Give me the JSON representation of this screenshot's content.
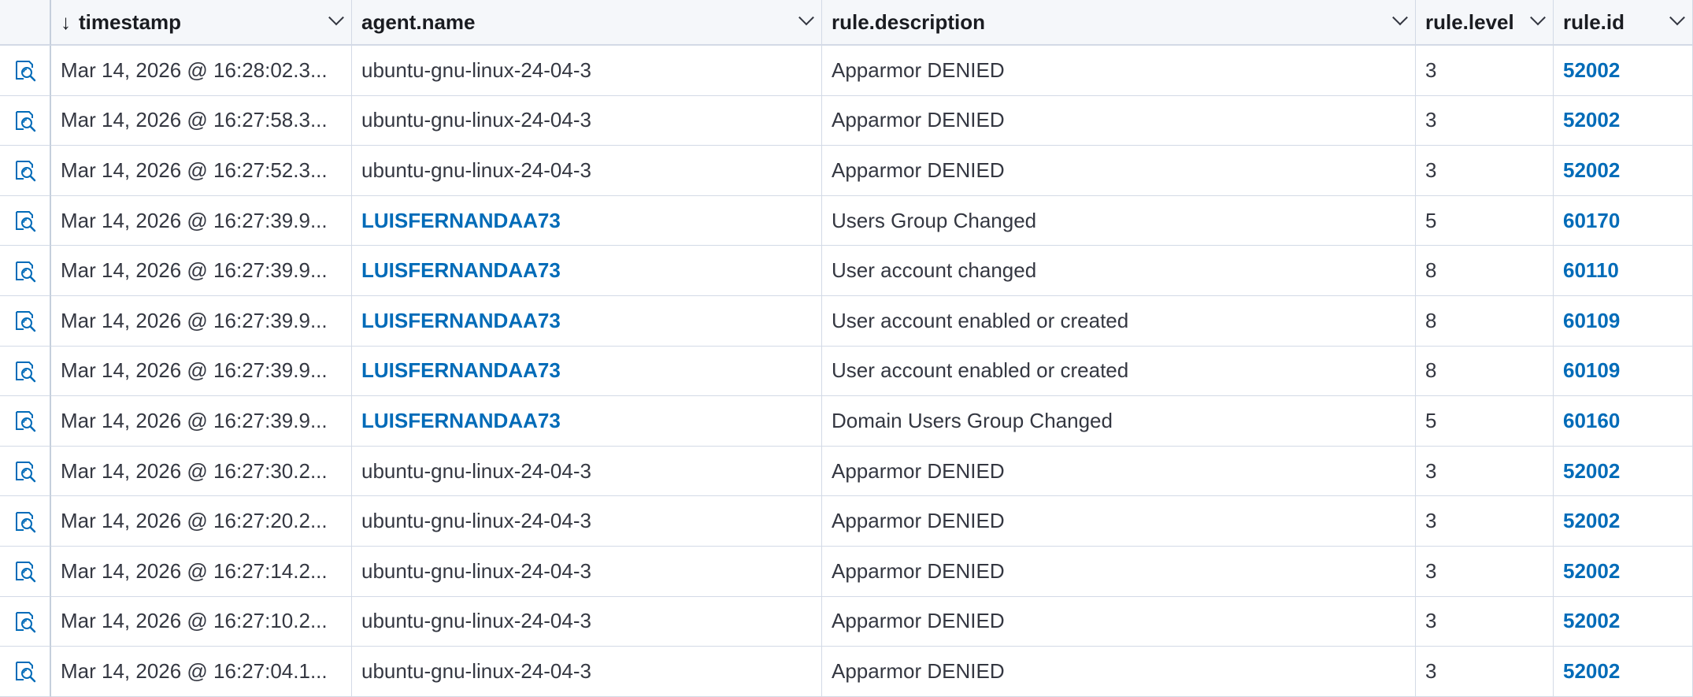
{
  "table": {
    "columns": [
      {
        "key": "timestamp",
        "label": "timestamp",
        "sorted": "desc"
      },
      {
        "key": "agent_name",
        "label": "agent.name"
      },
      {
        "key": "rule_description",
        "label": "rule.description"
      },
      {
        "key": "rule_level",
        "label": "rule.level"
      },
      {
        "key": "rule_id",
        "label": "rule.id"
      }
    ],
    "sort_arrow": "↓",
    "rows": [
      {
        "timestamp": "Mar 14, 2026 @ 16:28:02.3...",
        "agent_name": "ubuntu-gnu-linux-24-04-3",
        "agent_link": false,
        "rule_description": "Apparmor DENIED",
        "rule_level": "3",
        "rule_id": "52002"
      },
      {
        "timestamp": "Mar 14, 2026 @ 16:27:58.3...",
        "agent_name": "ubuntu-gnu-linux-24-04-3",
        "agent_link": false,
        "rule_description": "Apparmor DENIED",
        "rule_level": "3",
        "rule_id": "52002"
      },
      {
        "timestamp": "Mar 14, 2026 @ 16:27:52.3...",
        "agent_name": "ubuntu-gnu-linux-24-04-3",
        "agent_link": false,
        "rule_description": "Apparmor DENIED",
        "rule_level": "3",
        "rule_id": "52002"
      },
      {
        "timestamp": "Mar 14, 2026 @ 16:27:39.9...",
        "agent_name": "LUISFERNANDAA73",
        "agent_link": true,
        "rule_description": "Users Group Changed",
        "rule_level": "5",
        "rule_id": "60170"
      },
      {
        "timestamp": "Mar 14, 2026 @ 16:27:39.9...",
        "agent_name": "LUISFERNANDAA73",
        "agent_link": true,
        "rule_description": "User account changed",
        "rule_level": "8",
        "rule_id": "60110"
      },
      {
        "timestamp": "Mar 14, 2026 @ 16:27:39.9...",
        "agent_name": "LUISFERNANDAA73",
        "agent_link": true,
        "rule_description": "User account enabled or created",
        "rule_level": "8",
        "rule_id": "60109"
      },
      {
        "timestamp": "Mar 14, 2026 @ 16:27:39.9...",
        "agent_name": "LUISFERNANDAA73",
        "agent_link": true,
        "rule_description": "User account enabled or created",
        "rule_level": "8",
        "rule_id": "60109"
      },
      {
        "timestamp": "Mar 14, 2026 @ 16:27:39.9...",
        "agent_name": "LUISFERNANDAA73",
        "agent_link": true,
        "rule_description": "Domain Users Group Changed",
        "rule_level": "5",
        "rule_id": "60160"
      },
      {
        "timestamp": "Mar 14, 2026 @ 16:27:30.2...",
        "agent_name": "ubuntu-gnu-linux-24-04-3",
        "agent_link": false,
        "rule_description": "Apparmor DENIED",
        "rule_level": "3",
        "rule_id": "52002"
      },
      {
        "timestamp": "Mar 14, 2026 @ 16:27:20.2...",
        "agent_name": "ubuntu-gnu-linux-24-04-3",
        "agent_link": false,
        "rule_description": "Apparmor DENIED",
        "rule_level": "3",
        "rule_id": "52002"
      },
      {
        "timestamp": "Mar 14, 2026 @ 16:27:14.2...",
        "agent_name": "ubuntu-gnu-linux-24-04-3",
        "agent_link": false,
        "rule_description": "Apparmor DENIED",
        "rule_level": "3",
        "rule_id": "52002"
      },
      {
        "timestamp": "Mar 14, 2026 @ 16:27:10.2...",
        "agent_name": "ubuntu-gnu-linux-24-04-3",
        "agent_link": false,
        "rule_description": "Apparmor DENIED",
        "rule_level": "3",
        "rule_id": "52002"
      },
      {
        "timestamp": "Mar 14, 2026 @ 16:27:04.1...",
        "agent_name": "ubuntu-gnu-linux-24-04-3",
        "agent_link": false,
        "rule_description": "Apparmor DENIED",
        "rule_level": "3",
        "rule_id": "52002"
      }
    ]
  },
  "icons": {
    "row_control": "inspect-document-icon",
    "column_menu": "chevron-down-icon",
    "sort": "arrow-down-icon"
  },
  "colors": {
    "link": "#006bb8",
    "header_bg": "#f5f7fa",
    "border": "#d3dae6",
    "text": "#343741"
  }
}
